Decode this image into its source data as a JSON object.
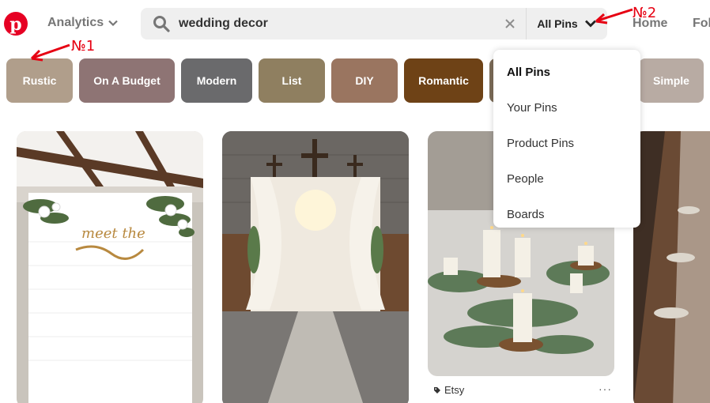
{
  "header": {
    "logo_letter": "p",
    "analytics_label": "Analytics",
    "search": {
      "value": "wedding decor",
      "placeholder": "Search"
    },
    "scope_label": "All Pins",
    "nav": {
      "home": "Home",
      "following": "Fol"
    }
  },
  "annotations": {
    "label1": "№1",
    "label2": "№2",
    "color": "#e60012"
  },
  "chips": [
    {
      "label": "Rustic",
      "color": "#b09e8b"
    },
    {
      "label": "On A Budget",
      "color": "#8e7474"
    },
    {
      "label": "Modern",
      "color": "#6a6a6c"
    },
    {
      "label": "List",
      "color": "#8f7f60"
    },
    {
      "label": "DIY",
      "color": "#9a7560"
    },
    {
      "label": "Romantic",
      "color": "#6e4216"
    },
    {
      "label": "Simple",
      "color": "#b8aba3"
    }
  ],
  "dropdown": {
    "items": [
      {
        "label": "All Pins",
        "selected": true
      },
      {
        "label": "Your Pins",
        "selected": false
      },
      {
        "label": "Product Pins",
        "selected": false
      },
      {
        "label": "People",
        "selected": false
      },
      {
        "label": "Boards",
        "selected": false
      }
    ]
  },
  "pins": {
    "pin1_sign_text": "meet the",
    "pin3_source": "Etsy",
    "more": "···"
  },
  "colors": {
    "brand": "#e60023",
    "search_bg": "#efefef"
  }
}
